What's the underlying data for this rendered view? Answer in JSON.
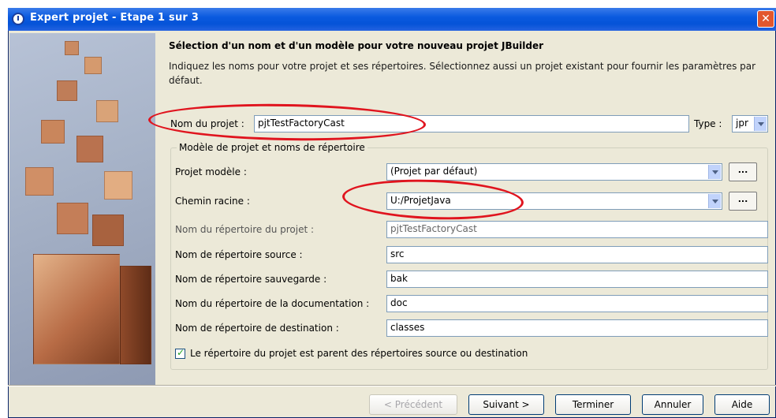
{
  "window": {
    "title": "Expert projet - Etape 1 sur 3"
  },
  "heading": "Sélection d'un nom et d'un modèle pour votre nouveau projet JBuilder",
  "description": "Indiquez les noms pour votre projet et ses répertoires. Sélectionnez aussi un projet existant pour fournir les paramètres par défaut.",
  "project": {
    "name_label": "Nom du projet :",
    "name_value": "pjtTestFactoryCast",
    "type_label": "Type :",
    "type_value": "jpr"
  },
  "group": {
    "legend": "Modèle de projet et noms de répertoire",
    "template_label": "Projet modèle :",
    "template_value": "(Projet par défaut)",
    "root_label": "Chemin racine :",
    "root_value": "U:/ProjetJava",
    "dots_label": "...",
    "project_dir_label": "Nom du répertoire du projet :",
    "project_dir_value": "pjtTestFactoryCast",
    "source_dir_label": "Nom de répertoire source :",
    "source_dir_value": "src",
    "backup_dir_label": "Nom de répertoire sauvegarde :",
    "backup_dir_value": "bak",
    "doc_dir_label": "Nom du répertoire de la documentation :",
    "doc_dir_value": "doc",
    "dest_dir_label": "Nom de répertoire de destination :",
    "dest_dir_value": "classes",
    "parent_checkbox_label": "Le répertoire du projet est parent des répertoires source ou destination",
    "parent_checkbox_checked": true
  },
  "buttons": {
    "previous": "< Précédent",
    "next": "Suivant >",
    "finish": "Terminer",
    "cancel": "Annuler",
    "help": "Aide"
  },
  "colors": {
    "titlebar": "#0553d8",
    "annotation": "#e0141e",
    "dialog_bg": "#ece9d8"
  }
}
